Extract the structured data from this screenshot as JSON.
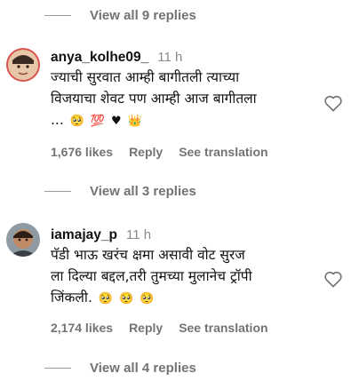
{
  "thread_top": {
    "view_replies": "View all 9 replies"
  },
  "comments": [
    {
      "username": "anya_kolhe09_",
      "time": "11 h",
      "text_lines": [
        "ज्याची सुरवात आम्ही बागीतली त्याच्या",
        "विजयाचा शेवट पण आम्ही आज बागीतला",
        "..."
      ],
      "emojis": [
        "🥺",
        "💯",
        "♥",
        "👑"
      ],
      "likes": "1,676 likes",
      "reply": "Reply",
      "translate": "See translation",
      "view_replies": "View all 3 replies"
    },
    {
      "username": "iamajay_p",
      "time": "11 h",
      "text_lines": [
        "पॅडी भाऊ खरंच क्षमा असावी वोट सुरज",
        "ला दिल्या बद्दल,तरी तुमच्या मुलानेच ट्रॉपी",
        "जिंकली."
      ],
      "emojis": [
        "🥺",
        "🥺",
        "🥺"
      ],
      "likes": "2,174 likes",
      "reply": "Reply",
      "translate": "See translation",
      "view_replies": "View all 4 replies"
    }
  ],
  "icons": {
    "like": "heart-outline-icon"
  },
  "colors": {
    "text": "#111111",
    "secondary": "#737373",
    "background": "#ffffff"
  }
}
